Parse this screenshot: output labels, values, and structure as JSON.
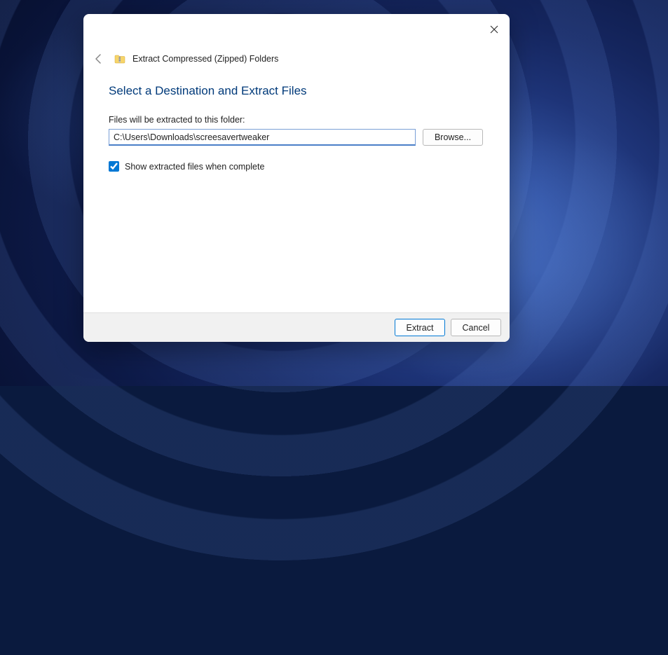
{
  "dialog": {
    "title": "Extract Compressed (Zipped) Folders",
    "heading": "Select a Destination and Extract Files",
    "field_label": "Files will be extracted to this folder:",
    "path_value": "C:\\Users\\Downloads\\screesavertweaker",
    "browse_label": "Browse...",
    "checkbox_label": "Show extracted files when complete",
    "checkbox_checked": true,
    "buttons": {
      "extract": "Extract",
      "cancel": "Cancel"
    }
  }
}
